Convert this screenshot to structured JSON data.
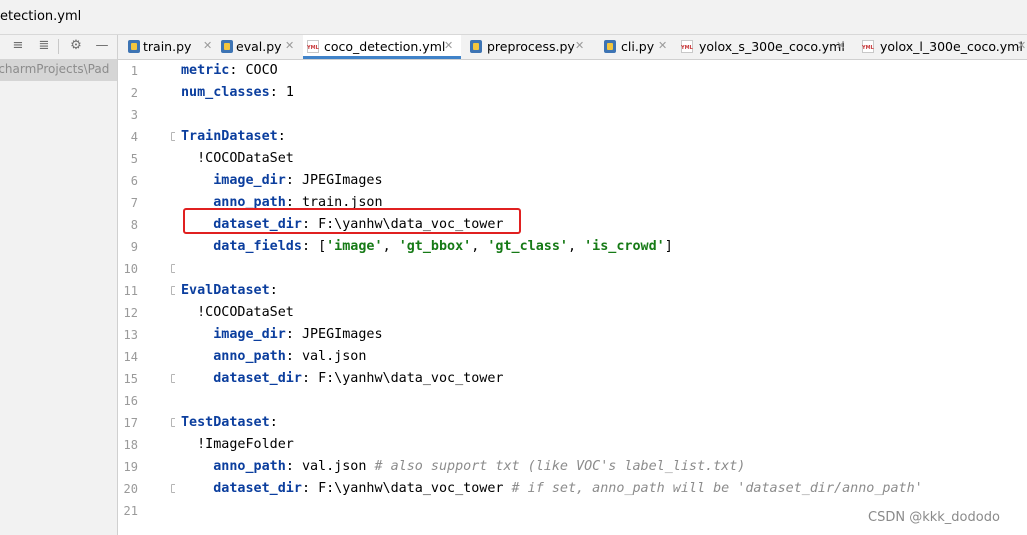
{
  "window": {
    "title": "etection.yml"
  },
  "left_panel": {
    "path": "PycharmProjects\\Pad"
  },
  "tabs": [
    {
      "label": "train.py",
      "icon": "python-file-icon",
      "active": false
    },
    {
      "label": "eval.py",
      "icon": "python-file-icon",
      "active": false
    },
    {
      "label": "coco_detection.yml",
      "icon": "yml-file-icon",
      "active": true
    },
    {
      "label": "preprocess.py",
      "icon": "python-file-icon",
      "active": false
    },
    {
      "label": "cli.py",
      "icon": "python-file-icon",
      "active": false
    },
    {
      "label": "yolox_s_300e_coco.yml",
      "icon": "yml-file-icon",
      "active": false
    },
    {
      "label": "yolox_l_300e_coco.yml",
      "icon": "yml-file-icon",
      "active": false
    }
  ],
  "editor": {
    "current_line": "12",
    "lines": [
      {
        "num": "1",
        "indent": "",
        "key": "metric",
        "sep": ": ",
        "value": "COCO"
      },
      {
        "num": "2",
        "indent": "",
        "key": "num_classes",
        "sep": ": ",
        "value": "1"
      },
      {
        "num": "3",
        "indent": "",
        "key": "",
        "sep": "",
        "value": ""
      },
      {
        "num": "4",
        "indent": "",
        "key": "TrainDataset",
        "sep": ":",
        "value": ""
      },
      {
        "num": "5",
        "indent": "  ",
        "tag": "!COCODataSet"
      },
      {
        "num": "6",
        "indent": "    ",
        "key": "image_dir",
        "sep": ": ",
        "value": "JPEGImages"
      },
      {
        "num": "7",
        "indent": "    ",
        "key": "anno_path",
        "sep": ": ",
        "value": "train.json"
      },
      {
        "num": "8",
        "indent": "    ",
        "key": "dataset_dir",
        "sep": ": ",
        "value": "F:\\yanhw\\data_voc_tower"
      },
      {
        "num": "9",
        "indent": "    ",
        "key": "data_fields",
        "sep": ": ",
        "list_open": "[",
        "list": [
          "'image'",
          "'gt_bbox'",
          "'gt_class'",
          "'is_crowd'"
        ],
        "list_sep": ", ",
        "list_close": "]"
      },
      {
        "num": "10",
        "indent": "",
        "key": "",
        "sep": "",
        "value": ""
      },
      {
        "num": "11",
        "indent": "",
        "key": "EvalDataset",
        "sep": ":",
        "value": ""
      },
      {
        "num": "12",
        "indent": "  ",
        "tag": "!COCODataSet"
      },
      {
        "num": "13",
        "indent": "    ",
        "key": "image_dir",
        "sep": ": ",
        "value": "JPEGImages"
      },
      {
        "num": "14",
        "indent": "    ",
        "key": "anno_path",
        "sep": ": ",
        "value": "val.json"
      },
      {
        "num": "15",
        "indent": "    ",
        "key": "dataset_dir",
        "sep": ": ",
        "value": "F:\\yanhw\\data_voc_tower"
      },
      {
        "num": "16",
        "indent": "",
        "key": "",
        "sep": "",
        "value": ""
      },
      {
        "num": "17",
        "indent": "",
        "key": "TestDataset",
        "sep": ":",
        "value": ""
      },
      {
        "num": "18",
        "indent": "  ",
        "tag": "!ImageFolder"
      },
      {
        "num": "19",
        "indent": "    ",
        "key": "anno_path",
        "sep": ": ",
        "value": "val.json",
        "comment": " # also support txt (like VOC's label_list.txt)"
      },
      {
        "num": "20",
        "indent": "    ",
        "key": "dataset_dir",
        "sep": ": ",
        "value": "F:\\yanhw\\data_voc_tower",
        "comment": " # if set, anno_path will be 'dataset_dir/anno_path'"
      },
      {
        "num": "21",
        "indent": "",
        "key": "",
        "sep": "",
        "value": ""
      }
    ]
  },
  "watermark": "CSDN @kkk_dododo",
  "colors": {
    "key": "#0b3e9e",
    "string": "#167a16",
    "comment": "#8c8c8c",
    "highlight_box": "#e02020",
    "tab_underline": "#4083c9"
  }
}
